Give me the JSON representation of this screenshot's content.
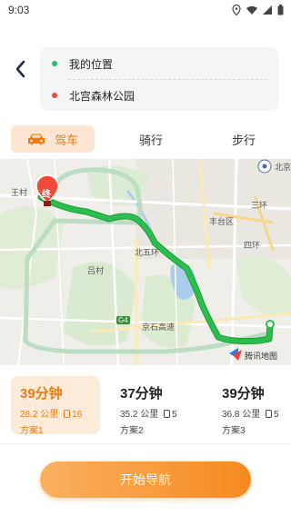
{
  "status_bar": {
    "time": "9:03",
    "icons": [
      "location-icon",
      "wifi-icon",
      "signal-icon",
      "battery-icon"
    ]
  },
  "route": {
    "origin": "我的位置",
    "destination": "北宫森林公园",
    "origin_color": "#22c06a",
    "destination_color": "#f04a3a"
  },
  "modes": [
    {
      "label": "驾车",
      "icon": "car-icon",
      "active": true
    },
    {
      "label": "骑行",
      "active": false
    },
    {
      "label": "步行",
      "active": false
    }
  ],
  "map": {
    "labels": {
      "dest_marker": "终",
      "wangcun": "王村",
      "beijing": "北京",
      "fengtai": "丰台区",
      "lucun": "吕村",
      "sihuan": "四环",
      "sanhuan": "三环",
      "g4": "G4",
      "jingshi": "京石高速",
      "beiwu": "北五环",
      "attribution": "腾讯地图"
    },
    "route_color": "#2bbd4e",
    "alt_route_color": "#bcdcc3"
  },
  "plans": [
    {
      "time": "39分钟",
      "distance": "28.2 公里",
      "lights": "16",
      "name": "方案1",
      "active": true
    },
    {
      "time": "37分钟",
      "distance": "35.2 公里",
      "lights": "5",
      "name": "方案2",
      "active": false
    },
    {
      "time": "39分钟",
      "distance": "36.8 公里",
      "lights": "5",
      "name": "方案3",
      "active": false
    }
  ],
  "start_button": "开始导航",
  "accent_color": "#f07a12"
}
